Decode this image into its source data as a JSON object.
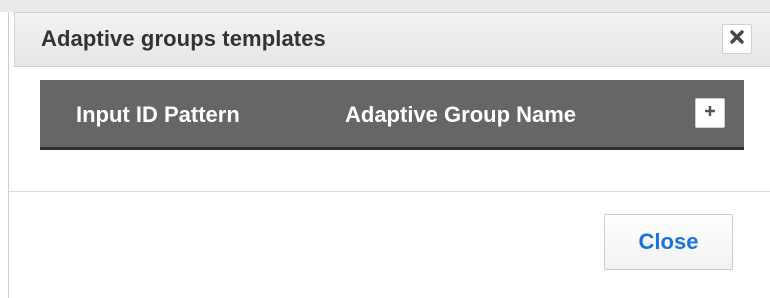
{
  "dialog": {
    "title": "Adaptive groups templates"
  },
  "table": {
    "columns": [
      {
        "label": "Input ID Pattern"
      },
      {
        "label": "Adaptive Group Name"
      }
    ],
    "rows": []
  },
  "footer": {
    "close_label": "Close"
  },
  "icons": {
    "close": "close-icon",
    "add": "plus-icon"
  },
  "colors": {
    "table_header_bg": "#666666",
    "close_text": "#1a73d8"
  }
}
